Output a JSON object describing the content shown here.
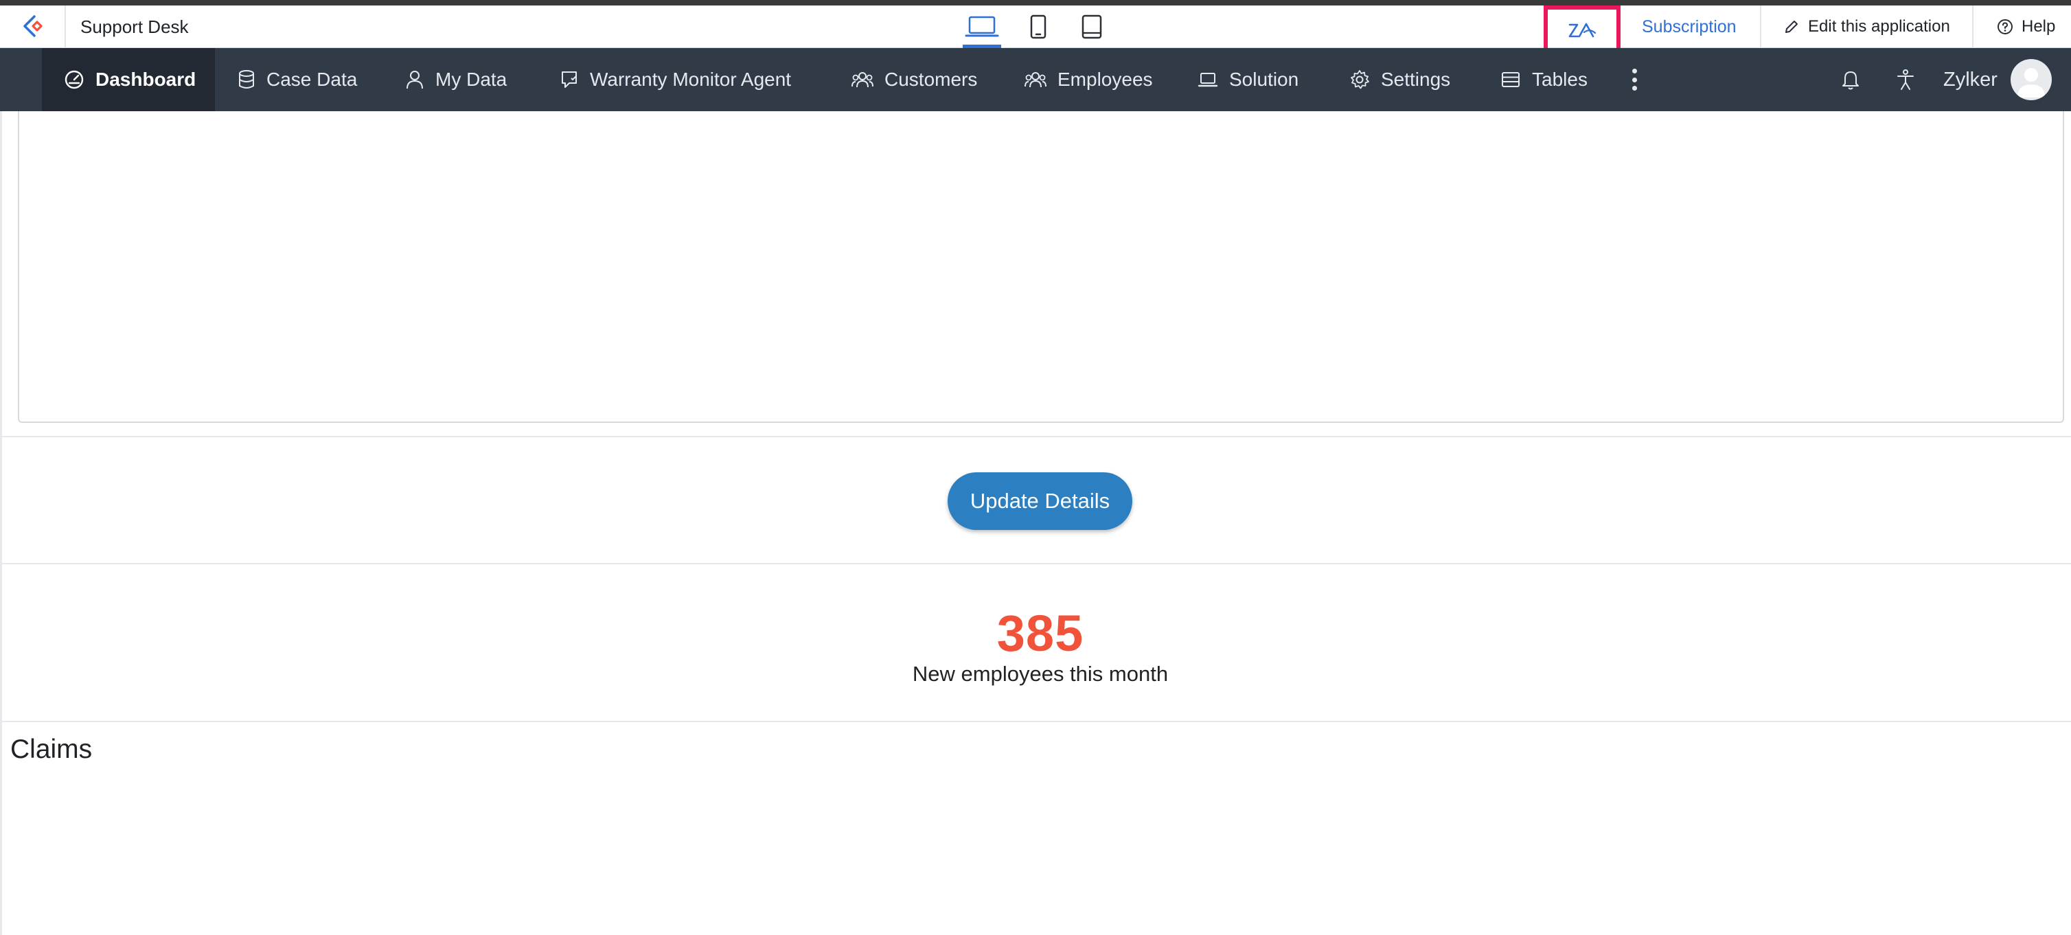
{
  "app": {
    "name": "Support Desk"
  },
  "topbar": {
    "devices": [
      {
        "name": "desktop",
        "active": true
      },
      {
        "name": "mobile",
        "active": false
      },
      {
        "name": "tablet",
        "active": false
      }
    ],
    "highlighted_icon": "zia-icon",
    "subscription_label": "Subscription",
    "edit_label": "Edit this application",
    "help_label": "Help",
    "accent_color": "#2f6fd6",
    "highlight_color": "#e8185a"
  },
  "nav": {
    "items": [
      {
        "label": "Dashboard",
        "icon": "dashboard-icon",
        "active": true
      },
      {
        "label": "Case Data",
        "icon": "database-icon",
        "active": false
      },
      {
        "label": "My Data",
        "icon": "user-icon",
        "active": false
      },
      {
        "label": "Warranty Monitor Agent",
        "icon": "agent-icon",
        "active": false
      },
      {
        "label": "Customers",
        "icon": "group-icon",
        "active": false
      },
      {
        "label": "Employees",
        "icon": "group-icon",
        "active": false
      },
      {
        "label": "Solution",
        "icon": "laptop-icon",
        "active": false
      },
      {
        "label": "Settings",
        "icon": "gear-icon",
        "active": false
      },
      {
        "label": "Tables",
        "icon": "table-icon",
        "active": false
      }
    ],
    "user_name": "Zylker",
    "bg_color": "#313a47"
  },
  "main": {
    "update_button_label": "Update Details",
    "stat": {
      "value": "385",
      "label": "New employees this month",
      "color": "#f0533a"
    },
    "claims_title": "Claims"
  }
}
